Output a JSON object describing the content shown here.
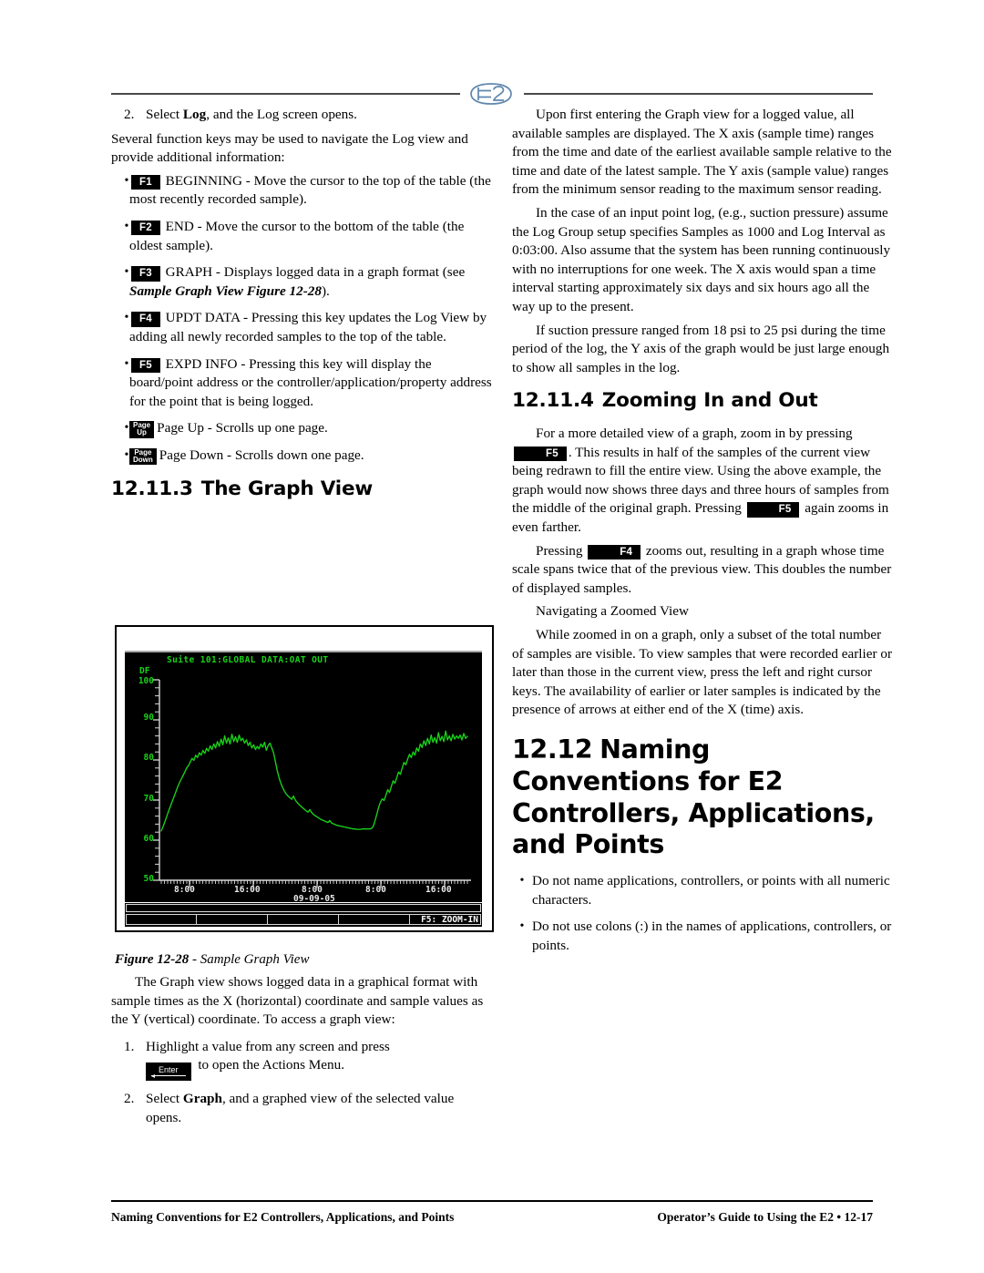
{
  "document": {
    "logo": "E2",
    "footer_left": "Naming Conventions for E2 Controllers, Applications, and Points",
    "footer_right": "Operator’s Guide to Using the E2 • 12-17"
  },
  "left_column": {
    "step2_num": "2.",
    "step2_pre": "Select ",
    "step2_bold": "Log",
    "step2_post": ", and the Log screen opens.",
    "intro": "Several function keys may be used to navigate the Log view and provide additional information:",
    "keys": [
      {
        "key": "F1",
        "text": "BEGINNING - Move the cursor to the top of the table (the most recently recorded sample)."
      },
      {
        "key": "F2",
        "text": "END - Move the cursor to the bottom of the table (the oldest sample)."
      },
      {
        "key": "F3",
        "text_pre": "GRAPH - Displays logged data in a graph format (see ",
        "text_bolditalic": "Sample Graph View Figure 12-28",
        "text_post": ")."
      },
      {
        "key": "F4",
        "text": "UPDT DATA - Pressing this key updates the Log View by adding all newly recorded samples to the top of the table."
      },
      {
        "key": "F5",
        "text": "EXPD INFO - Pressing this key will display the board/point address or the controller/application/property address for the point that is being logged."
      }
    ],
    "page_keys": [
      {
        "line1": "Page",
        "line2": "Up",
        "text": "Page Up - Scrolls up one page."
      },
      {
        "line1": "Page",
        "line2": "Down",
        "text": "Page Down - Scrolls down one page."
      }
    ],
    "section_number": "12.11.3",
    "section_title": "The Graph View",
    "figure_caption_bold": "Figure 12-28",
    "figure_caption_rest": " - ",
    "figure_caption_italic": "Sample Graph View",
    "after_figure_para": "The Graph view shows logged data in a graphical format with sample times as the X (horizontal) coordinate and sample values as the Y (vertical) coordinate. To access a graph view:",
    "steps": [
      {
        "num": "1.",
        "pre": "Highlight a value from any screen and press ",
        "key": "Enter",
        "post": " to open the Actions Menu."
      },
      {
        "num": "2.",
        "pre": "Select ",
        "bold": "Graph",
        "post": ", and a graphed view of the selected value opens."
      }
    ]
  },
  "right_column": {
    "para1": "Upon first entering the Graph view for a logged value, all available samples are displayed. The X axis (sample time) ranges from the time and date of the earliest available sample relative to the time and date of the latest sample. The Y axis (sample value) ranges from the minimum sensor reading to the maximum sensor reading.",
    "para2": "In the case of an input point log, (e.g., suction pressure) assume the Log Group setup specifies Samples as 1000 and Log Interval as 0:03:00. Also assume that the system has been running continuously with no interruptions for one week. The X axis would span a time interval starting approximately six days and six hours ago all the way up to the present.",
    "para3": "If suction pressure ranged from 18 psi to 25 psi during the time period of the log, the Y axis of the graph would be just large enough to show all samples in the log.",
    "section_number": "12.11.4",
    "section_title": "Zooming In and Out",
    "zoom_p1_a": "For a more detailed view of a graph, zoom in by pressing ",
    "zoom_p1_key": "F5",
    "zoom_p1_b": ". This results in half of the samples of the current view being redrawn to fill the entire view. Using the above example, the graph would now shows three days and three hours of samples from the middle of the original graph. Pressing ",
    "zoom_p1_key2": "F5",
    "zoom_p1_c": " again zooms in even farther.",
    "zoom_p2_a": "Pressing ",
    "zoom_p2_key": "F4",
    "zoom_p2_b": " zooms out, resulting in a graph whose time scale spans twice that of the previous view. This doubles the number of displayed samples.",
    "nav_heading": "Navigating a Zoomed View",
    "nav_para": "While zoomed in on a graph, only a subset of the total number of samples are visible. To view samples that were recorded earlier or later than those in the current view, press the left and right cursor keys. The availability of earlier or later samples is indicated by the presence of arrows at either end of the X (time) axis.",
    "big_section_number": "12.12",
    "big_section_title": "Naming Conventions for E2 Controllers, Applications, and Points",
    "bullets": [
      "Do not name applications, controllers, or points with all numeric characters.",
      "Do not use colons (:) in the names of applications, controllers, or points."
    ]
  },
  "chart_data": {
    "type": "line",
    "title": "Suite 101:GLOBAL DATA:OAT OUT",
    "ylabel": "DF",
    "ylim": [
      50,
      100
    ],
    "yticks": [
      "100",
      "90",
      "80",
      "70",
      "60",
      "50"
    ],
    "ytick_values": [
      100,
      90,
      80,
      70,
      60,
      50
    ],
    "xtick_labels": [
      "8:00",
      "16:00",
      "8:00",
      "8:00",
      "16:00"
    ],
    "xtick_positions": [
      0.085,
      0.29,
      0.495,
      0.7,
      0.905
    ],
    "xlabel": "09-09-05",
    "status_key": "F5: ZOOM-IN",
    "line_color": "#19d219",
    "background": "#000000",
    "grid": false,
    "series": [
      {
        "name": "OAT OUT",
        "values": [
          62.3,
          63.4,
          64.6,
          65.9,
          67.2,
          68.4,
          69.6,
          70.8,
          72.0,
          73.2,
          74.3,
          75.2,
          76.1,
          77.0,
          78.0,
          78.6,
          79.5,
          80.4,
          79.9,
          81.2,
          80.6,
          81.8,
          81.2,
          82.4,
          81.6,
          82.9,
          82.2,
          83.5,
          82.6,
          84.0,
          83.0,
          84.6,
          83.4,
          85.2,
          83.8,
          86.0,
          84.2,
          85.5,
          84.0,
          86.4,
          84.6,
          85.8,
          84.4,
          86.2,
          84.8,
          85.4,
          84.2,
          85.0,
          83.6,
          84.4,
          83.0,
          83.8,
          82.6,
          83.4,
          82.8,
          84.0,
          83.2,
          84.4,
          82.4,
          83.6,
          84.2,
          83.0,
          81.8,
          79.6,
          77.4,
          75.6,
          74.2,
          73.1,
          72.2,
          71.5,
          71.0,
          70.6,
          70.2,
          71.0,
          70.0,
          69.4,
          68.9,
          68.5,
          68.1,
          67.7,
          67.3,
          67.0,
          67.6,
          66.9,
          66.4,
          66.1,
          65.8,
          65.5,
          65.2,
          65.0,
          64.8,
          64.6,
          64.4,
          64.9,
          64.3,
          64.1,
          63.9,
          63.7,
          63.6,
          63.5,
          63.4,
          63.3,
          63.2,
          63.1,
          63.0,
          62.9,
          62.8,
          62.8,
          62.7,
          62.7,
          62.7,
          62.8,
          62.8,
          62.8,
          62.8,
          62.8,
          62.9,
          63.4,
          64.8,
          66.5,
          68.2,
          69.5,
          70.3,
          69.9,
          71.2,
          72.6,
          71.9,
          73.4,
          74.8,
          74.2,
          75.6,
          77.0,
          76.4,
          78.0,
          79.4,
          78.8,
          80.2,
          81.4,
          80.6,
          82.0,
          81.2,
          83.0,
          82.2,
          84.0,
          83.1,
          84.8,
          83.6,
          85.4,
          84.0,
          86.2,
          84.4,
          85.6,
          84.2,
          86.8,
          84.8,
          85.9,
          84.6,
          87.2,
          85.0,
          86.0,
          84.8,
          86.4,
          85.2,
          86.0,
          85.4,
          86.2,
          85.0,
          86.6,
          85.4,
          85.9
        ]
      }
    ]
  }
}
